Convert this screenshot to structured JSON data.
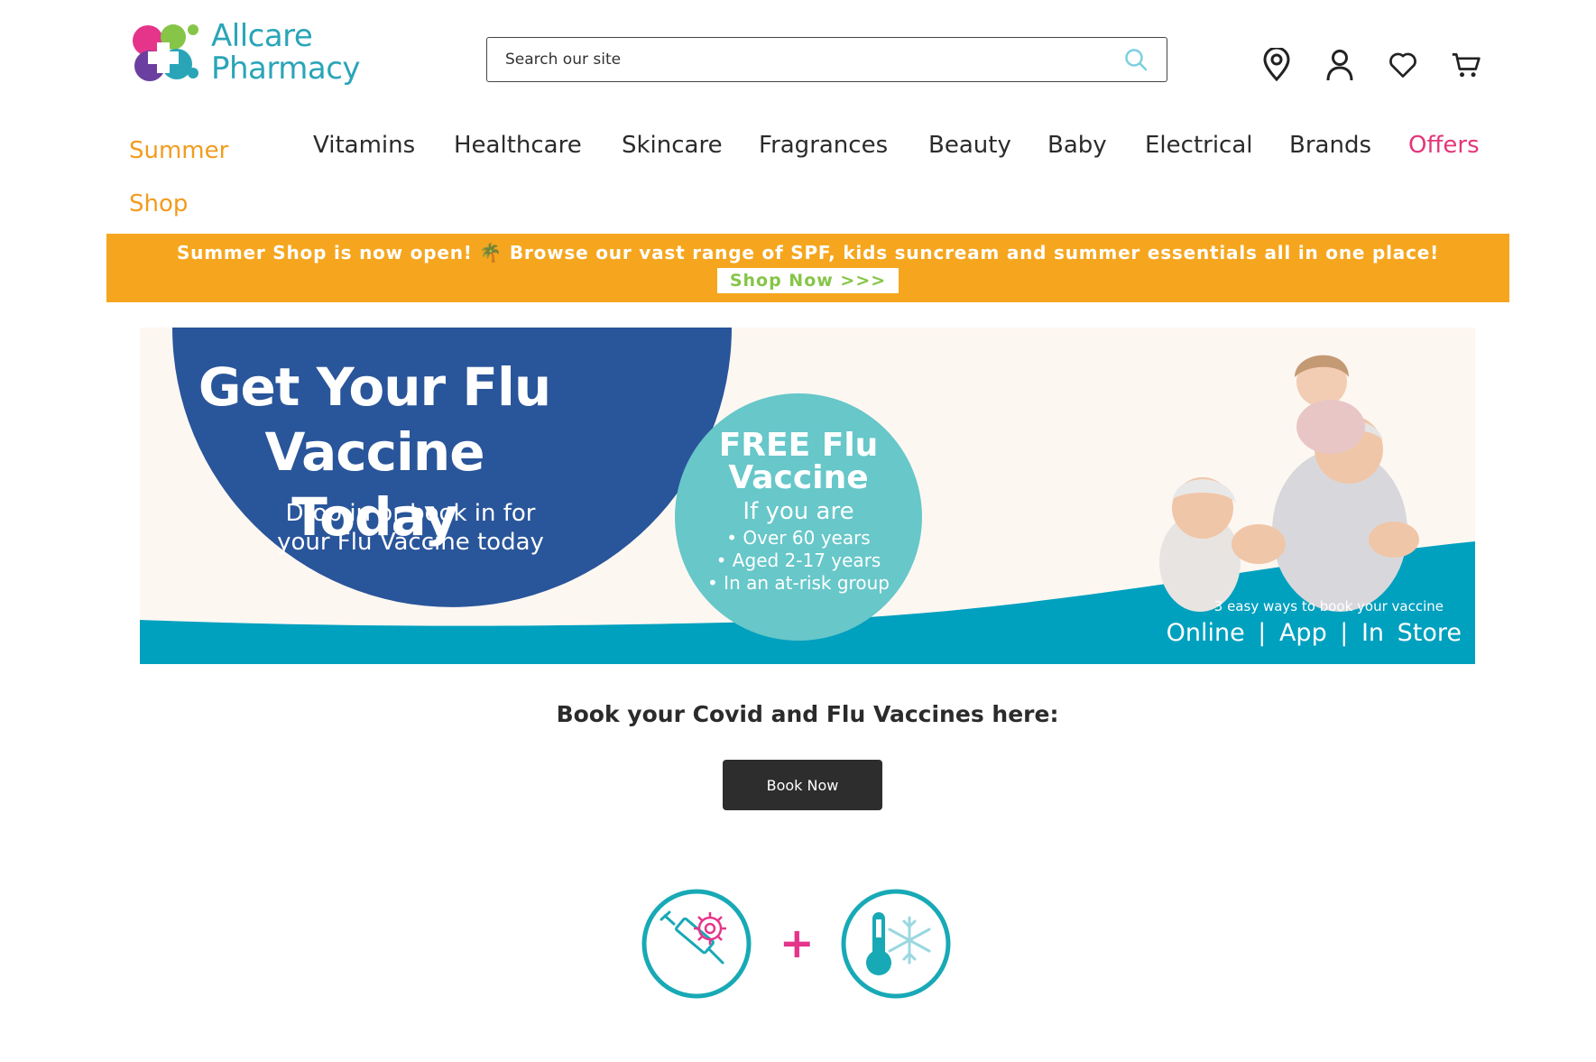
{
  "header": {
    "brand_line1": "Allcare",
    "brand_line2": "Pharmacy",
    "search_placeholder": "Search our site",
    "icons": [
      "location-pin-icon",
      "account-icon",
      "heart-icon",
      "cart-icon"
    ]
  },
  "nav": {
    "items": [
      {
        "label": "Summer Shop",
        "color": "#f29c1f"
      },
      {
        "label": "Vitamins"
      },
      {
        "label": "Healthcare"
      },
      {
        "label": "Skincare"
      },
      {
        "label": "Fragrances"
      },
      {
        "label": "Beauty"
      },
      {
        "label": "Baby"
      },
      {
        "label": "Electrical"
      },
      {
        "label": "Brands"
      },
      {
        "label": "Offers",
        "color": "#e5357a"
      }
    ]
  },
  "promo": {
    "text": "Summer Shop is now open! 🌴 Browse our vast range of SPF, kids suncream and summer essentials all in one place!",
    "button": "Shop Now >>>",
    "background": "#f6a61e"
  },
  "hero": {
    "title": "Get Your Flu Vaccine Today",
    "subtitle": "Drop in or book in for your Flu Vaccine today",
    "free_heading": "FREE Flu Vaccine",
    "if_you_are": "If you are",
    "eligibility": [
      "• Over 60 years",
      "• Aged 2-17 years",
      "• In an at-risk group"
    ],
    "ways_small": "3 easy ways to book your vaccine",
    "ways_big": "Online | App | In Store",
    "colors": {
      "navy": "#29559a",
      "teal": "#00a0bf",
      "light_teal": "#67c7c9"
    }
  },
  "booking": {
    "heading": "Book your Covid and Flu Vaccines here:",
    "button": "Book Now"
  },
  "vaccine_icons": {
    "left": "covid-syringe-icon",
    "plus": "+",
    "right": "flu-thermometer-icon"
  }
}
